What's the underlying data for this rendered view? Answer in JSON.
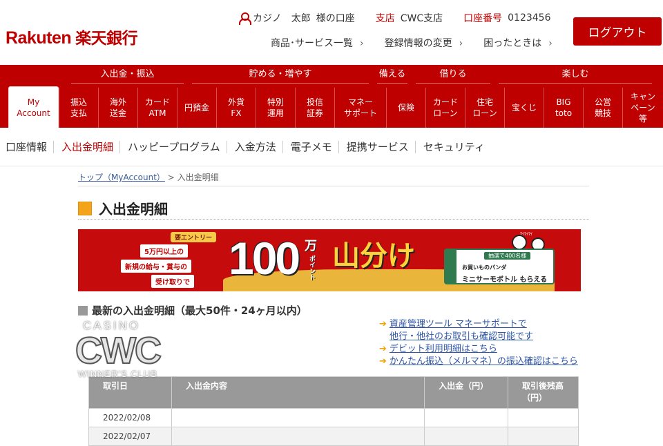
{
  "header": {
    "logo_en": "Rakuten",
    "logo_jp": "楽天銀行",
    "user_name": "カジノ　太郎",
    "user_suffix": "様の口座",
    "branch_label": "支店",
    "branch_value": "CWC支店",
    "account_label": "口座番号",
    "account_value": "0123456",
    "links": [
      "商品･サービス一覧",
      "登録情報の変更",
      "困ったときは"
    ],
    "logout_label": "ログアウト"
  },
  "nav": {
    "groups": [
      {
        "label": "入出金・振込"
      },
      {
        "label": "貯める・増やす"
      },
      {
        "label": "備える"
      },
      {
        "label": "借りる"
      },
      {
        "label": "楽しむ"
      }
    ],
    "tabs": [
      {
        "label": "My\nAccount",
        "active": true
      },
      {
        "label": "振込\n支払"
      },
      {
        "label": "海外\n送金"
      },
      {
        "label": "カード\nATM"
      },
      {
        "label": "円預金"
      },
      {
        "label": "外貨\nFX"
      },
      {
        "label": "特別\n運用"
      },
      {
        "label": "投信\n証券"
      },
      {
        "label": "マネー\nサポート"
      },
      {
        "label": "保険"
      },
      {
        "label": "カード\nローン"
      },
      {
        "label": "住宅\nローン"
      },
      {
        "label": "宝くじ"
      },
      {
        "label": "BIG\ntoto"
      },
      {
        "label": "公営\n競技"
      },
      {
        "label": "キャン\nペーン\n等"
      }
    ]
  },
  "subnav": {
    "items": [
      "口座情報",
      "入出金明細",
      "ハッピープログラム",
      "入金方法",
      "電子メモ",
      "提携サービス",
      "セキュリティ"
    ],
    "active_index": 1
  },
  "breadcrumb": {
    "top_link": "トップ（MyAccount）",
    "separator": ">",
    "current": "入出金明細"
  },
  "page_title": "入出金明細",
  "banner": {
    "tag": "要エントリー",
    "line1": "5万円以上の",
    "line2": "新規の給与・賞与の",
    "line3": "受け取りで",
    "big": "100",
    "unit_top": "万",
    "unit_side": "ポイント",
    "headline": "山分け",
    "panda_text": "ﾏｲﾏｲﾏｲ",
    "card_tag": "抽選で400名様",
    "card_line1": "お買いものパンダ",
    "card_line2": "ミニサーモボトル もらえる"
  },
  "section": {
    "title": "最新の入出金明細（最大50件・24ヶ月以内）"
  },
  "links": {
    "items": [
      {
        "line1": "資産管理ツール マネーサポートで",
        "line2": "他行・他社のお取引も確認可能です"
      },
      {
        "line1": "デビット利用明細はこちら"
      },
      {
        "line1": "かんたん振込（メルマネ）の振込確認はこちら"
      }
    ]
  },
  "table": {
    "headers": [
      "取引日",
      "入出金内容",
      "入出金（円）",
      "取引後残高（円）"
    ],
    "rows": [
      [
        "2022/02/08",
        "",
        "",
        ""
      ],
      [
        "2022/02/07",
        "",
        "",
        ""
      ]
    ]
  },
  "watermark": {
    "line1": "CASINO",
    "line2": "CWC",
    "line3": "WINNER'S CLUB"
  }
}
